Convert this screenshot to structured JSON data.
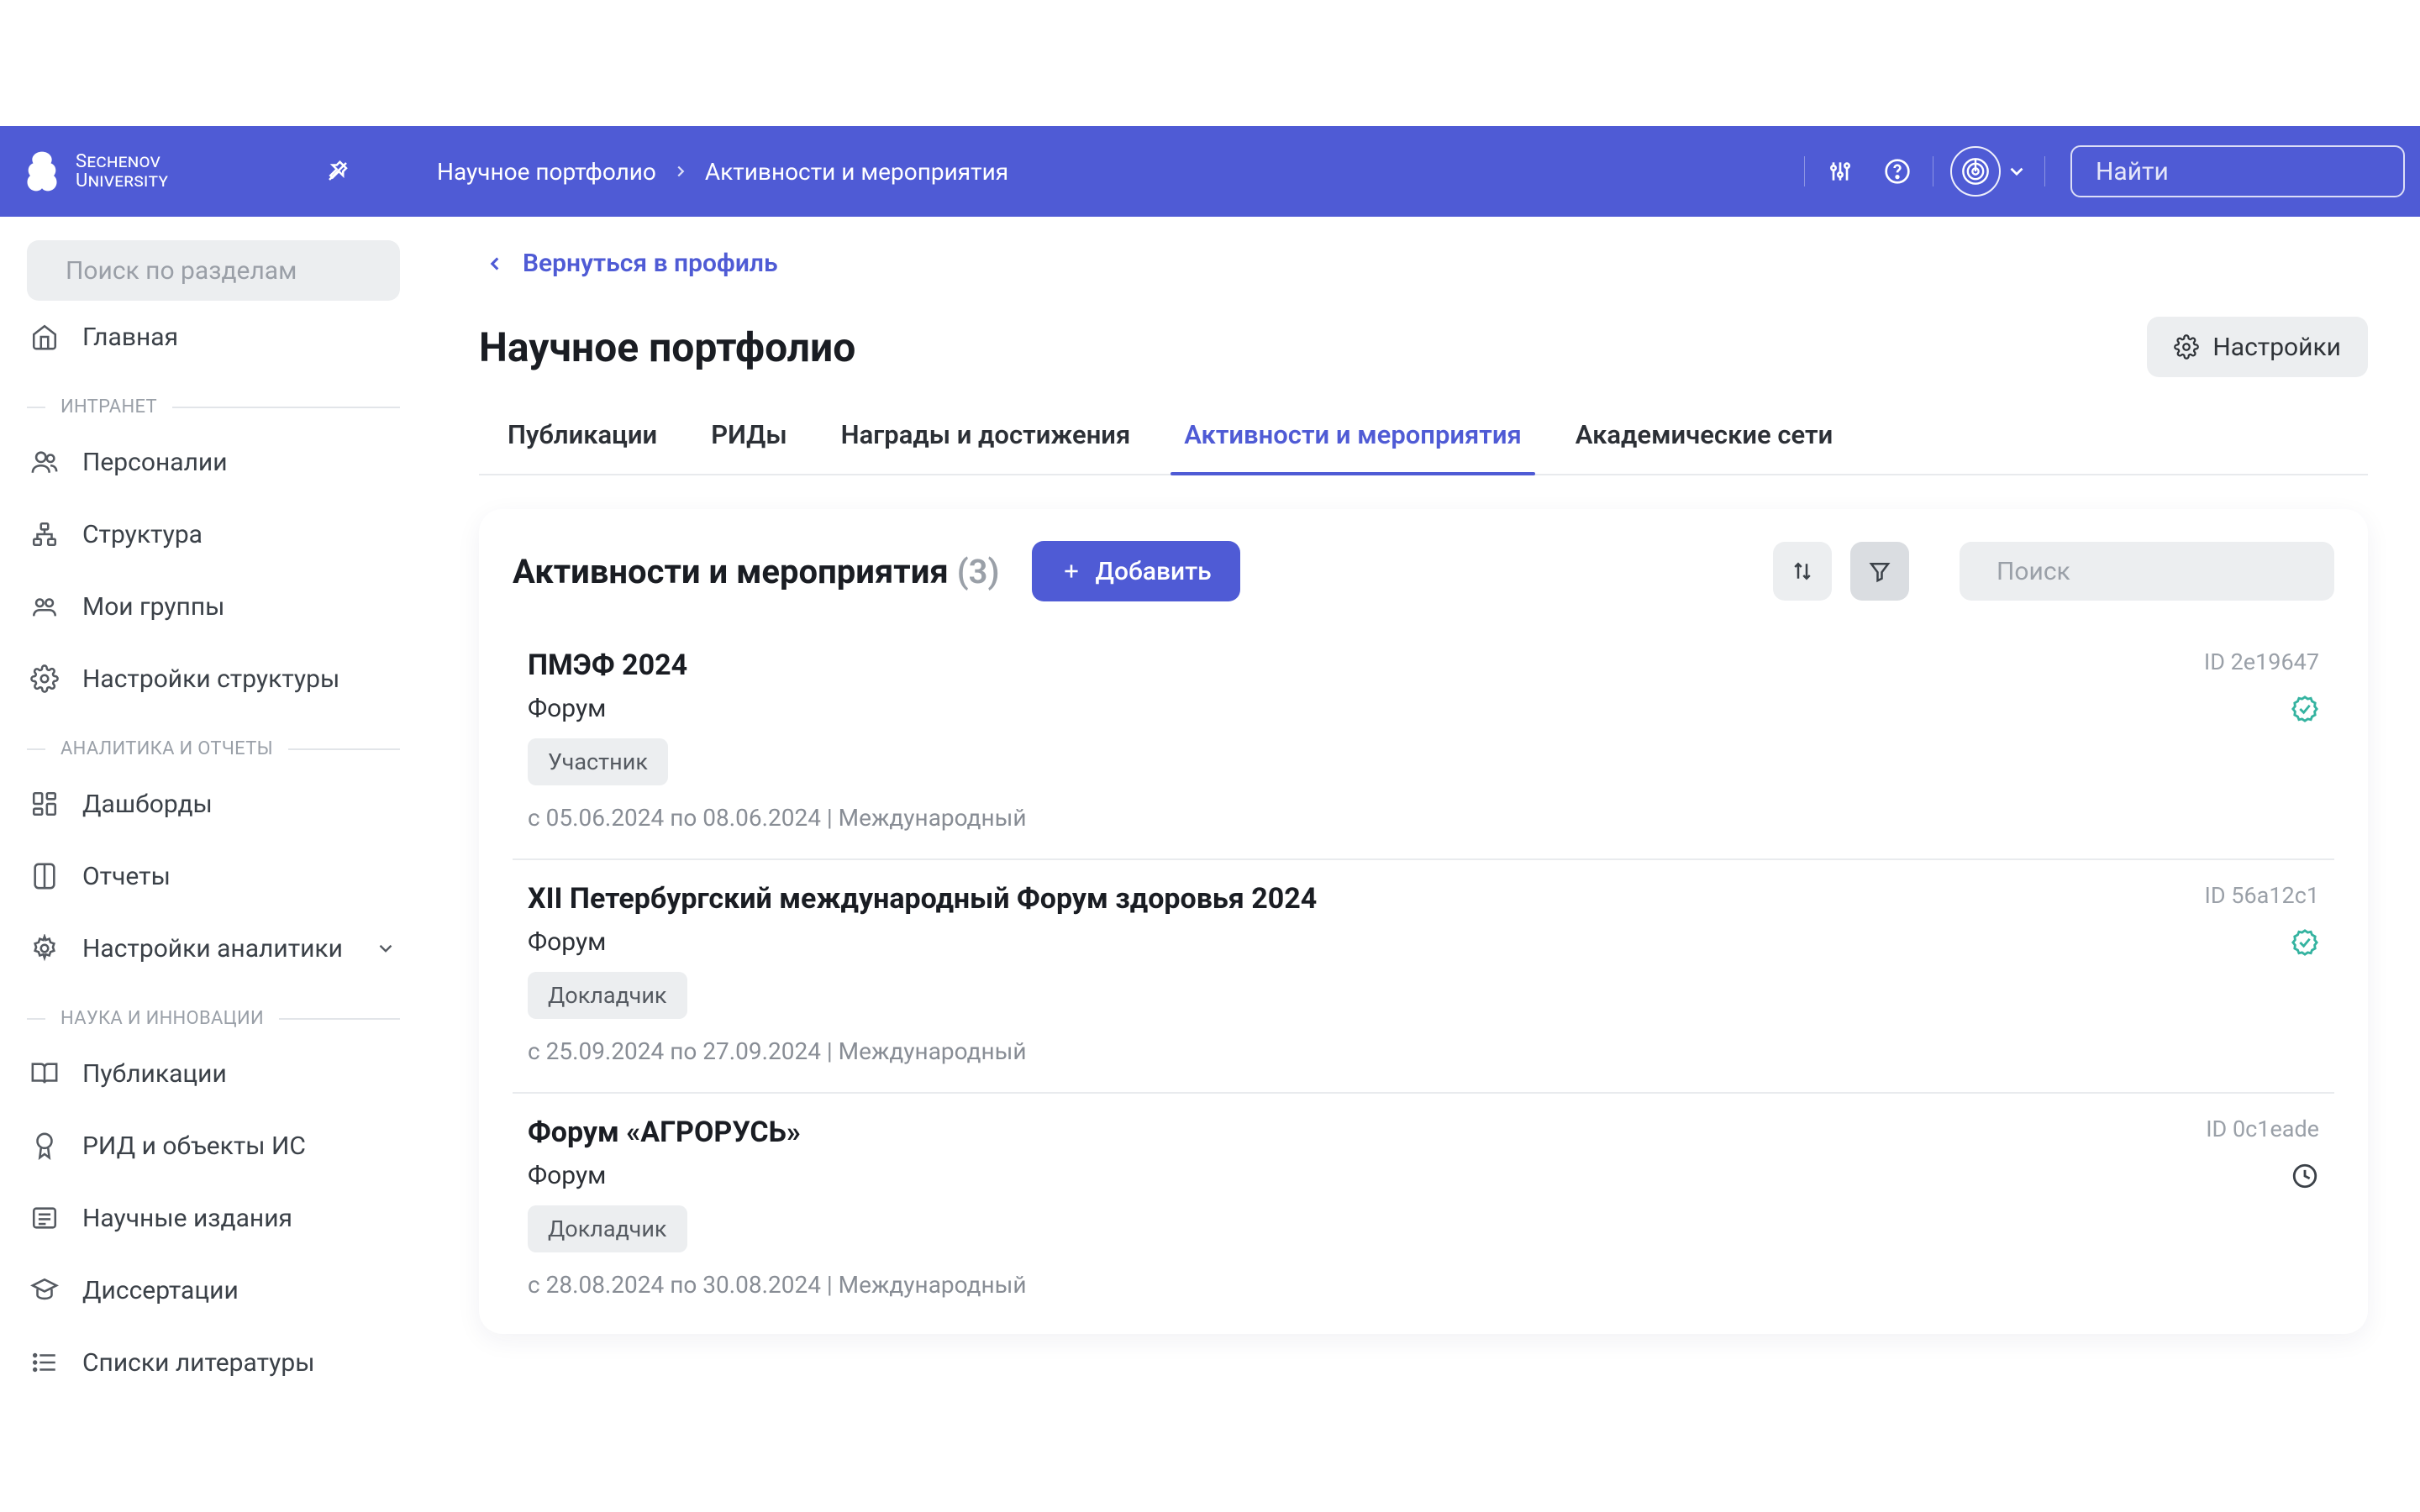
{
  "header": {
    "logo_text_1": "Sechenov",
    "logo_text_2": "University",
    "breadcrumb": {
      "items": [
        "Научное портфолио",
        "Активности и мероприятия"
      ]
    },
    "search_placeholder": "Найти"
  },
  "sidebar": {
    "search_placeholder": "Поиск по разделам",
    "main_label": "Главная",
    "section_intranet": "ИНТРАНЕТ",
    "section_analytics": "АНАЛИТИКА И ОТЧЕТЫ",
    "section_science": "НАУКА И ИННОВАЦИИ",
    "items": {
      "personalii": "Персоналии",
      "struktura": "Структура",
      "moi_gruppy": "Мои группы",
      "nastroiki_struktury": "Настройки структуры",
      "dashbordy": "Дашборды",
      "otchety": "Отчеты",
      "nastroiki_analitiki": "Настройки аналитики",
      "publikacii": "Публикации",
      "rid_obekty": "РИД и объекты ИС",
      "nauchnye_izdaniya": "Научные издания",
      "dissertacii": "Диссертации",
      "spiski_literatury": "Списки литературы"
    }
  },
  "main": {
    "back_label": "Вернуться в профиль",
    "title": "Научное портфолио",
    "settings_label": "Настройки",
    "tabs": [
      "Публикации",
      "РИДы",
      "Награды и достижения",
      "Активности и мероприятия",
      "Академические сети"
    ],
    "panel": {
      "title": "Активности и мероприятия",
      "count": "(3)",
      "add_label": "Добавить",
      "search_placeholder": "Поиск"
    },
    "events": [
      {
        "name": "ПМЭФ 2024",
        "id": "ID 2e19647",
        "type": "Форум",
        "badge": "Участник",
        "meta": "с 05.06.2024 по 08.06.2024 | Международный",
        "status": "verified"
      },
      {
        "name": "XII Петербургский международный Форум здоровья 2024",
        "id": "ID 56a12c1",
        "type": "Форум",
        "badge": "Докладчик",
        "meta": "с 25.09.2024 по 27.09.2024 | Международный",
        "status": "verified"
      },
      {
        "name": "Форум «АГРОРУСЬ»",
        "id": "ID 0c1eade",
        "type": "Форум",
        "badge": "Докладчик",
        "meta": "с 28.08.2024 по 30.08.2024 | Международный",
        "status": "pending"
      }
    ]
  },
  "colors": {
    "primary": "#4F5BD5",
    "verified": "#34b3a0"
  }
}
